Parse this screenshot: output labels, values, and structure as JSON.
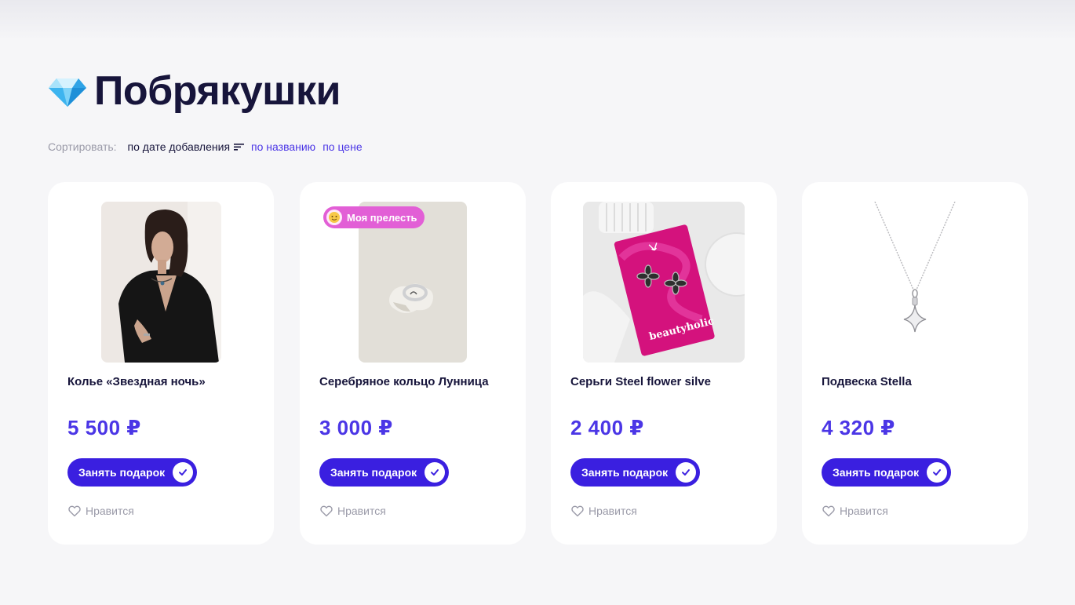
{
  "page": {
    "title": "Побрякушки",
    "title_icon": "gem-icon"
  },
  "sort": {
    "label": "Сортировать:",
    "options": [
      {
        "label": "по дате добавления",
        "active": true
      },
      {
        "label": "по названию",
        "active": false
      },
      {
        "label": "по цене",
        "active": false
      }
    ]
  },
  "colors": {
    "accent": "#4b36e6",
    "button": "#3a1fe0",
    "badge": "#e25fd6",
    "background": "#f6f6f8"
  },
  "products": [
    {
      "name": "Колье «Звездная ночь»",
      "price": "5 500 ₽",
      "button": "Занять подарок",
      "like": "Нравится",
      "image": "woman-in-black-with-necklace"
    },
    {
      "name": "Серебряное кольцо Лунница",
      "price": "3 000 ₽",
      "button": "Занять подарок",
      "like": "Нравится",
      "image": "silver-ring-on-stone",
      "badge": "Моя прелесть"
    },
    {
      "name": "Серьги Steel flower silve",
      "price": "2 400 ₽",
      "button": "Занять подарок",
      "like": "Нравится",
      "image": "flower-earrings-on-pink-card",
      "card_text": "beautyholic"
    },
    {
      "name": "Подвеска Stella",
      "price": "4 320 ₽",
      "button": "Занять подарок",
      "like": "Нравится",
      "image": "silver-star-pendant"
    }
  ]
}
